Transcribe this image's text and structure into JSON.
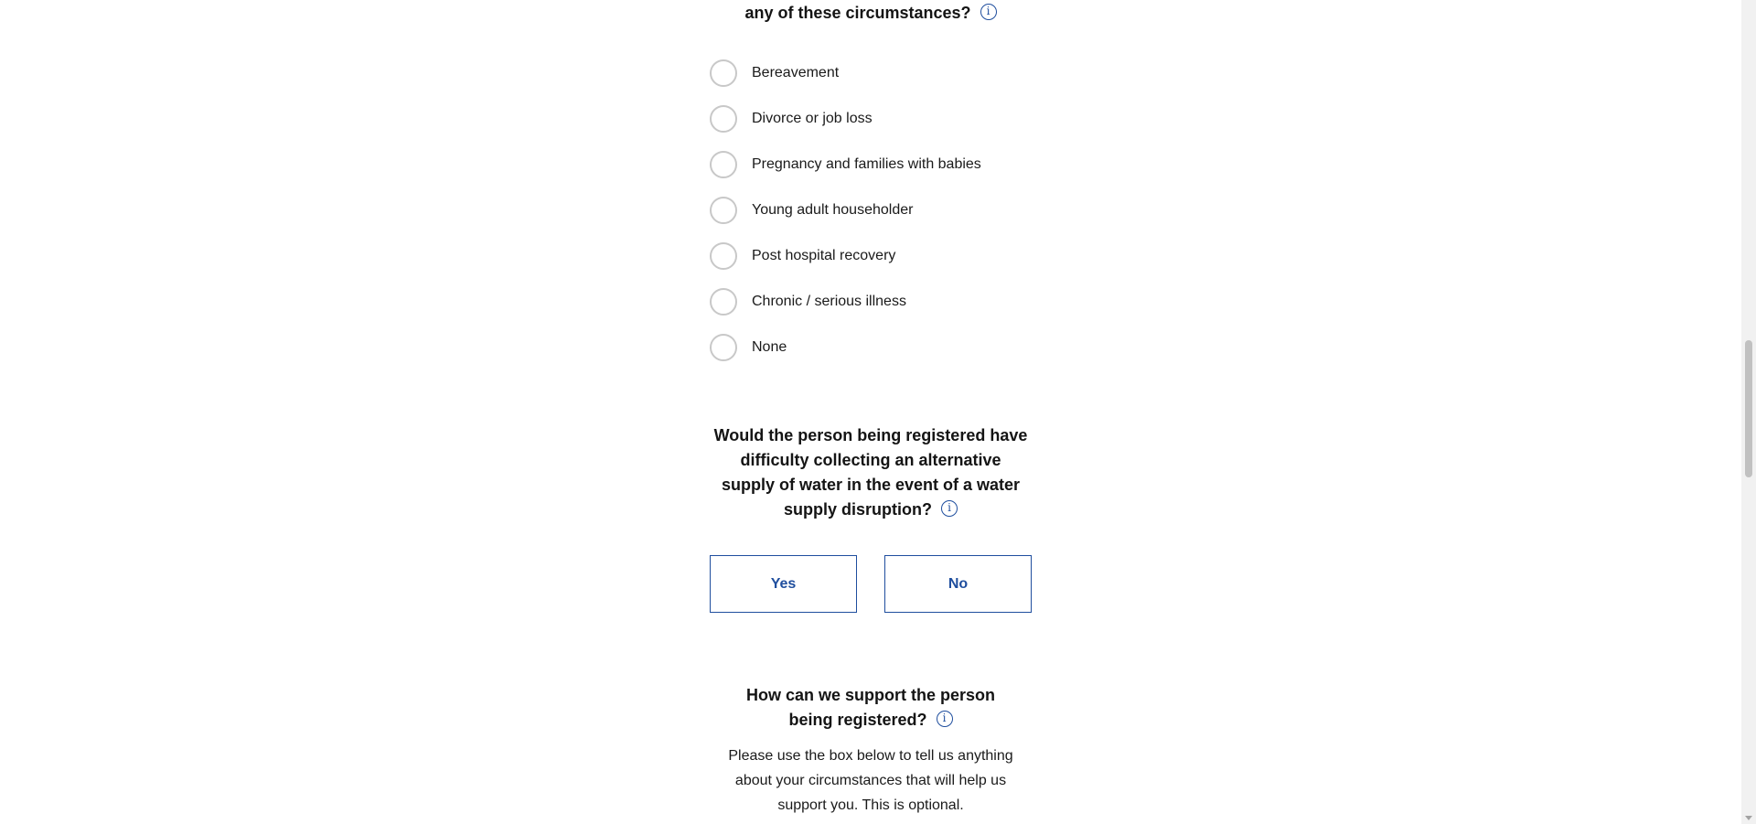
{
  "question1": {
    "heading_tail": "any of these circumstances?",
    "info_icon": "info-icon",
    "options": [
      "Bereavement",
      "Divorce or job loss",
      "Pregnancy and families with babies",
      "Young adult householder",
      "Post hospital recovery",
      "Chronic / serious illness",
      "None"
    ]
  },
  "question2": {
    "heading": "Would the person being registered have difficulty collecting an alternative supply of water in the event of a water supply disruption?",
    "info_icon": "info-icon",
    "yes_label": "Yes",
    "no_label": "No"
  },
  "question3": {
    "heading": "How can we support the person being registered?",
    "info_icon": "info-icon",
    "helper_text": "Please use the box below to tell us anything about your circumstances that will help us support you. This is optional."
  },
  "colors": {
    "accent": "#1f4e9e",
    "radio_border": "#c8c8c8",
    "text": "#141414"
  }
}
